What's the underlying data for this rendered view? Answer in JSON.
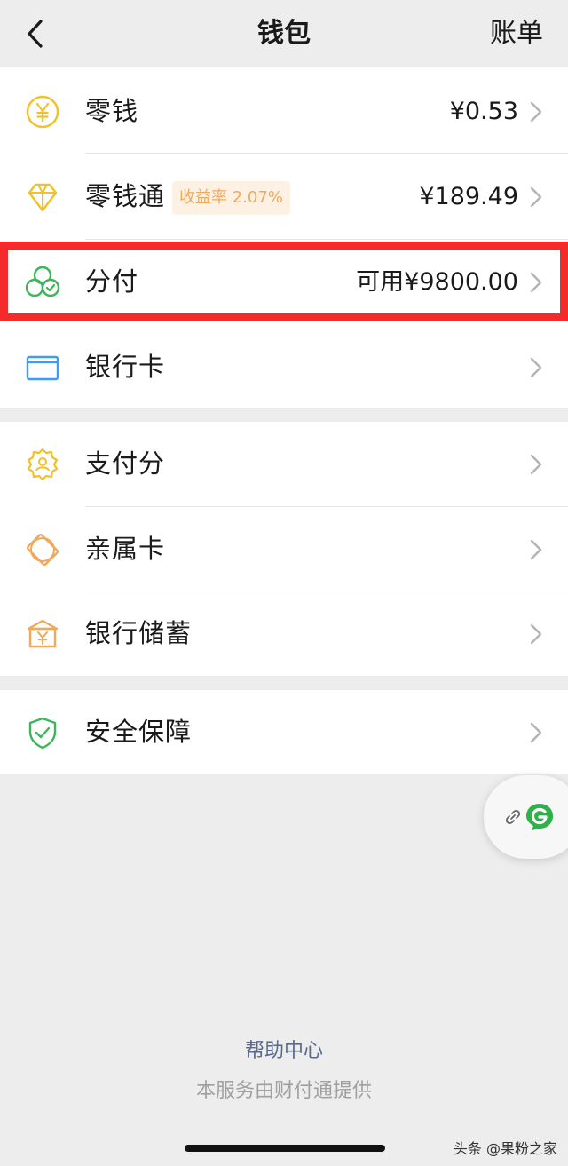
{
  "header": {
    "title": "钱包",
    "right_label": "账单"
  },
  "wallet_rows": [
    {
      "label": "零钱",
      "value": "¥0.53",
      "icon": "yen-coin-icon"
    },
    {
      "label": "零钱通",
      "badge": "收益率 2.07%",
      "value": "¥189.49",
      "icon": "diamond-icon"
    },
    {
      "label": "分付",
      "value": "可用¥9800.00",
      "icon": "fenfu-clover-icon"
    },
    {
      "label": "银行卡",
      "value": "",
      "icon": "bank-card-icon"
    }
  ],
  "service_rows": [
    {
      "label": "支付分",
      "icon": "pay-score-badge-icon"
    },
    {
      "label": "亲属卡",
      "icon": "family-card-icon"
    },
    {
      "label": "银行储蓄",
      "icon": "bank-savings-icon"
    }
  ],
  "security_rows": [
    {
      "label": "安全保障",
      "icon": "shield-check-icon"
    }
  ],
  "footer": {
    "help_link": "帮助中心",
    "provider_text": "本服务由财付通提供"
  },
  "watermark": "头条 @果粉之家",
  "colors": {
    "highlight_border": "#f52a2a",
    "coin_yellow": "#f2c029",
    "fenfu_green": "#3cb65a",
    "card_blue": "#3d9cf5",
    "orange": "#f0a85c"
  }
}
